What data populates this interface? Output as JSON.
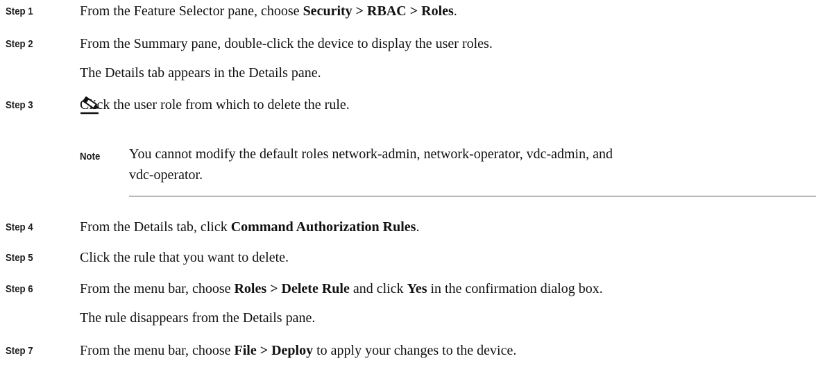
{
  "steps": [
    {
      "label": "Step 1",
      "parts": [
        "From the Feature Selector pane, choose ",
        "Security > RBAC > Roles",
        "."
      ]
    },
    {
      "label": "Step 2",
      "text": "From the Summary pane, double-click the device to display the user roles.",
      "sub": "The Details tab appears in the Details pane."
    },
    {
      "label": "Step 3",
      "text": "Click the user role from which to delete the rule."
    },
    {
      "label": "Step 4",
      "parts": [
        "From the Details tab, click ",
        "Command Authorization Rules",
        "."
      ]
    },
    {
      "label": "Step 5",
      "text": "Click the rule that you want to delete."
    },
    {
      "label": "Step 6",
      "parts": [
        "From the menu bar, choose ",
        "Roles > Delete Rule",
        " and click ",
        "Yes",
        " in the confirmation dialog box."
      ],
      "sub": "The rule disappears from the Details pane."
    },
    {
      "label": "Step 7",
      "parts": [
        "From the menu bar, choose ",
        "File > Deploy",
        " to apply your changes to the device."
      ]
    }
  ],
  "note": {
    "label": "Note",
    "line1": "You cannot modify the default roles network-admin, network-operator, vdc-admin, and",
    "line2": "vdc-operator.",
    "icon": "pencil-note-icon"
  }
}
